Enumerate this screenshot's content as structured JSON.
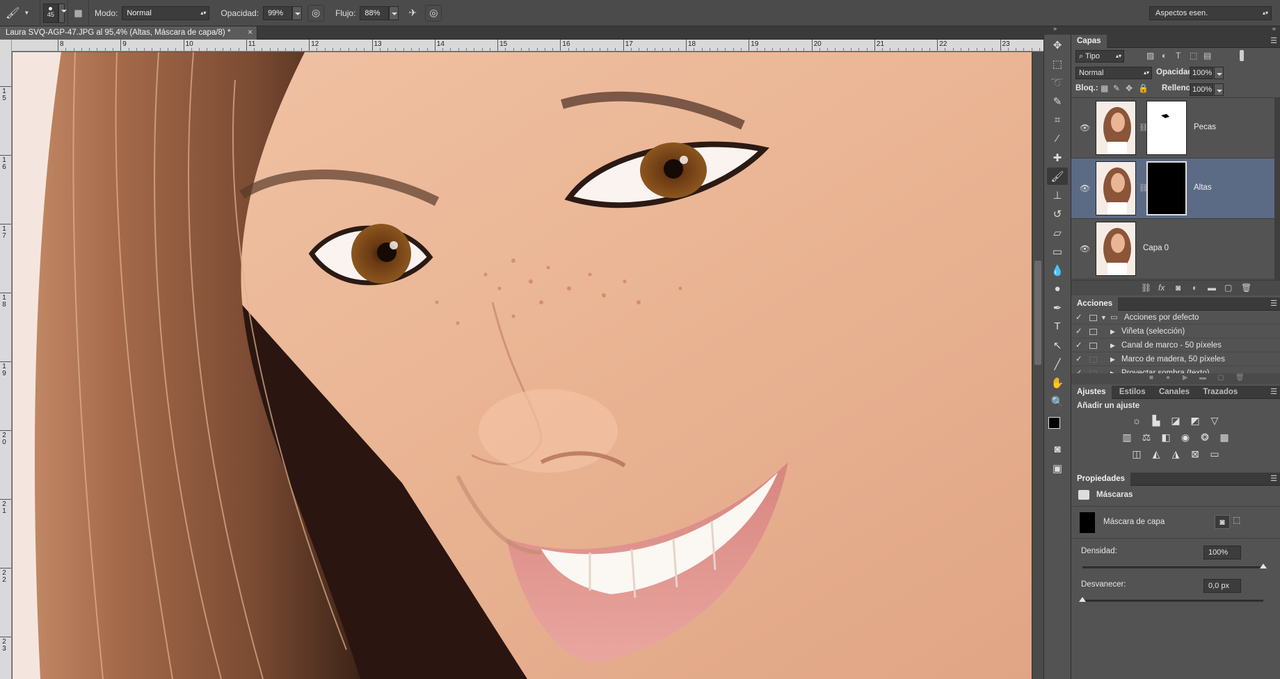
{
  "options_bar": {
    "brush_size": "45",
    "mode_label": "Modo:",
    "mode_value": "Normal",
    "opacity_label": "Opacidad:",
    "opacity_value": "99%",
    "flow_label": "Flujo:",
    "flow_value": "88%",
    "workspace": "Aspectos esen."
  },
  "document_tab": {
    "title": "Laura SVQ-AGP-47.JPG al 95,4% (Altas, Máscara de capa/8) *",
    "close": "×"
  },
  "rulers": {
    "top": [
      "8",
      "9",
      "10",
      "11",
      "12",
      "13",
      "14",
      "15",
      "16",
      "17",
      "18",
      "19",
      "20",
      "21",
      "22",
      "23"
    ],
    "left": [
      "1\n5",
      "1\n6",
      "1\n7",
      "1\n8",
      "1\n9",
      "2\n0",
      "2\n1",
      "2\n2",
      "2\n3"
    ]
  },
  "layers_panel": {
    "tab": "Capas",
    "filter": "Tipo",
    "blend_mode": "Normal",
    "opacity_label": "Opacidad:",
    "opacity_value": "100%",
    "lock_label": "Bloq.:",
    "fill_label": "Relleno:",
    "fill_value": "100%",
    "layers": [
      {
        "name": "Pecas"
      },
      {
        "name": "Altas"
      },
      {
        "name": "Capa 0"
      }
    ]
  },
  "actions_panel": {
    "tab": "Acciones",
    "items": [
      {
        "label": "Acciones por defecto"
      },
      {
        "label": "Viñeta (selección)"
      },
      {
        "label": "Canal de marco - 50 píxeles"
      },
      {
        "label": "Marco de madera, 50 píxeles"
      },
      {
        "label": "Proyectar sombra (texto)"
      }
    ]
  },
  "adjustments_panel": {
    "tabs": [
      "Ajustes",
      "Estilos",
      "Canales",
      "Trazados"
    ],
    "title": "Añadir un ajuste"
  },
  "properties_panel": {
    "tab": "Propiedades",
    "section": "Máscaras",
    "mask_label": "Máscara de capa",
    "density_label": "Densidad:",
    "density_value": "100%",
    "feather_label": "Desvanecer:",
    "feather_value": "0,0 px"
  }
}
